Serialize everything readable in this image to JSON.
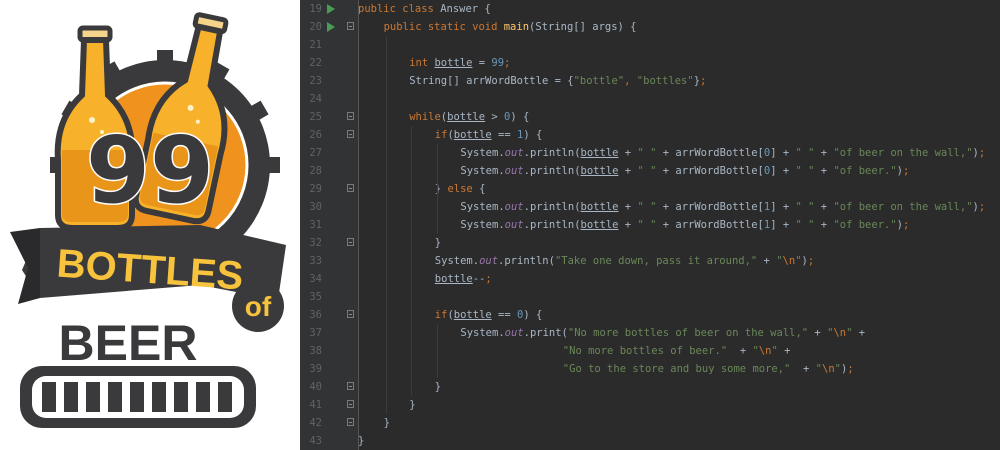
{
  "logo": {
    "number": "99",
    "word1": "BOTTLES",
    "word2": "of",
    "word3": "BEER"
  },
  "editor": {
    "lines": [
      {
        "n": "19",
        "run": true,
        "fold": false,
        "indent": 0,
        "tokens": [
          [
            "kw",
            "public "
          ],
          [
            "kw",
            "class "
          ],
          [
            "plain",
            "Answer {"
          ]
        ]
      },
      {
        "n": "20",
        "run": true,
        "fold": true,
        "indent": 4,
        "tokens": [
          [
            "kw",
            "public "
          ],
          [
            "kw",
            "static "
          ],
          [
            "kw",
            "void "
          ],
          [
            "fn",
            "main"
          ],
          [
            "plain",
            "(String[] args) {"
          ]
        ]
      },
      {
        "n": "21",
        "tokens": []
      },
      {
        "n": "22",
        "indent": 8,
        "tokens": [
          [
            "kw",
            "int "
          ],
          [
            "var",
            "bottle"
          ],
          [
            "plain",
            " = "
          ],
          [
            "num",
            "99"
          ],
          [
            "kw",
            ";"
          ]
        ]
      },
      {
        "n": "23",
        "indent": 8,
        "tokens": [
          [
            "plain",
            "String[] arrWordBottle = {"
          ],
          [
            "str",
            "\"bottle\""
          ],
          [
            "kw",
            ", "
          ],
          [
            "str",
            "\"bottles\""
          ],
          [
            "plain",
            "}"
          ],
          [
            "kw",
            ";"
          ]
        ]
      },
      {
        "n": "24",
        "tokens": []
      },
      {
        "n": "25",
        "fold": true,
        "indent": 8,
        "tokens": [
          [
            "kw",
            "while"
          ],
          [
            "plain",
            "("
          ],
          [
            "var",
            "bottle"
          ],
          [
            "plain",
            " > "
          ],
          [
            "num",
            "0"
          ],
          [
            "plain",
            ") {"
          ]
        ]
      },
      {
        "n": "26",
        "fold": true,
        "indent": 12,
        "tokens": [
          [
            "kw",
            "if"
          ],
          [
            "plain",
            "("
          ],
          [
            "var",
            "bottle"
          ],
          [
            "plain",
            " == "
          ],
          [
            "num",
            "1"
          ],
          [
            "plain",
            ") {"
          ]
        ]
      },
      {
        "n": "27",
        "indent": 16,
        "tokens": [
          [
            "plain",
            "System."
          ],
          [
            "fld",
            "out"
          ],
          [
            "plain",
            ".println("
          ],
          [
            "var",
            "bottle"
          ],
          [
            "plain",
            " + "
          ],
          [
            "str",
            "\" \""
          ],
          [
            "plain",
            " + arrWordBottle["
          ],
          [
            "num",
            "0"
          ],
          [
            "plain",
            "] + "
          ],
          [
            "str",
            "\" \""
          ],
          [
            "plain",
            " + "
          ],
          [
            "str",
            "\"of beer on the wall,\""
          ],
          [
            "plain",
            ")"
          ],
          [
            "kw",
            ";"
          ]
        ]
      },
      {
        "n": "28",
        "indent": 16,
        "tokens": [
          [
            "plain",
            "System."
          ],
          [
            "fld",
            "out"
          ],
          [
            "plain",
            ".println("
          ],
          [
            "var",
            "bottle"
          ],
          [
            "plain",
            " + "
          ],
          [
            "str",
            "\" \""
          ],
          [
            "plain",
            " + arrWordBottle["
          ],
          [
            "num",
            "0"
          ],
          [
            "plain",
            "] + "
          ],
          [
            "str",
            "\" \""
          ],
          [
            "plain",
            " + "
          ],
          [
            "str",
            "\"of beer.\""
          ],
          [
            "plain",
            ")"
          ],
          [
            "kw",
            ";"
          ]
        ]
      },
      {
        "n": "29",
        "fold": true,
        "indent": 12,
        "tokens": [
          [
            "plain",
            "} "
          ],
          [
            "kw",
            "else "
          ],
          [
            "plain",
            "{"
          ]
        ]
      },
      {
        "n": "30",
        "indent": 16,
        "tokens": [
          [
            "plain",
            "System."
          ],
          [
            "fld",
            "out"
          ],
          [
            "plain",
            ".println("
          ],
          [
            "var",
            "bottle"
          ],
          [
            "plain",
            " + "
          ],
          [
            "str",
            "\" \""
          ],
          [
            "plain",
            " + arrWordBottle["
          ],
          [
            "num",
            "1"
          ],
          [
            "plain",
            "] + "
          ],
          [
            "str",
            "\" \""
          ],
          [
            "plain",
            " + "
          ],
          [
            "str",
            "\"of beer on the wall,\""
          ],
          [
            "plain",
            ")"
          ],
          [
            "kw",
            ";"
          ]
        ]
      },
      {
        "n": "31",
        "indent": 16,
        "tokens": [
          [
            "plain",
            "System."
          ],
          [
            "fld",
            "out"
          ],
          [
            "plain",
            ".println("
          ],
          [
            "var",
            "bottle"
          ],
          [
            "plain",
            " + "
          ],
          [
            "str",
            "\" \""
          ],
          [
            "plain",
            " + arrWordBottle["
          ],
          [
            "num",
            "1"
          ],
          [
            "plain",
            "] + "
          ],
          [
            "str",
            "\" \""
          ],
          [
            "plain",
            " + "
          ],
          [
            "str",
            "\"of beer.\""
          ],
          [
            "plain",
            ")"
          ],
          [
            "kw",
            ";"
          ]
        ]
      },
      {
        "n": "32",
        "fold": true,
        "indent": 12,
        "tokens": [
          [
            "plain",
            "}"
          ]
        ]
      },
      {
        "n": "33",
        "indent": 12,
        "tokens": [
          [
            "plain",
            "System."
          ],
          [
            "fld",
            "out"
          ],
          [
            "plain",
            ".println("
          ],
          [
            "str",
            "\"Take one down, pass it around,\""
          ],
          [
            "plain",
            " + "
          ],
          [
            "str",
            "\""
          ],
          [
            "esc",
            "\\n"
          ],
          [
            "str",
            "\""
          ],
          [
            "plain",
            ")"
          ],
          [
            "kw",
            ";"
          ]
        ]
      },
      {
        "n": "34",
        "indent": 12,
        "tokens": [
          [
            "var",
            "bottle"
          ],
          [
            "plain",
            "--"
          ],
          [
            "kw",
            ";"
          ]
        ]
      },
      {
        "n": "35",
        "tokens": []
      },
      {
        "n": "36",
        "fold": true,
        "indent": 12,
        "tokens": [
          [
            "kw",
            "if"
          ],
          [
            "plain",
            "("
          ],
          [
            "var",
            "bottle"
          ],
          [
            "plain",
            " == "
          ],
          [
            "num",
            "0"
          ],
          [
            "plain",
            ") {"
          ]
        ]
      },
      {
        "n": "37",
        "indent": 16,
        "tokens": [
          [
            "plain",
            "System."
          ],
          [
            "fld",
            "out"
          ],
          [
            "plain",
            ".print("
          ],
          [
            "str",
            "\"No more bottles of beer on the wall,\""
          ],
          [
            "plain",
            " + "
          ],
          [
            "str",
            "\""
          ],
          [
            "esc",
            "\\n"
          ],
          [
            "str",
            "\""
          ],
          [
            "plain",
            " +"
          ]
        ]
      },
      {
        "n": "38",
        "indent": 32,
        "tokens": [
          [
            "str",
            "\"No more bottles of beer.\""
          ],
          [
            "plain",
            "  + "
          ],
          [
            "str",
            "\""
          ],
          [
            "esc",
            "\\n"
          ],
          [
            "str",
            "\""
          ],
          [
            "plain",
            " +"
          ]
        ]
      },
      {
        "n": "39",
        "indent": 32,
        "tokens": [
          [
            "str",
            "\"Go to the store and buy some more,\""
          ],
          [
            "plain",
            "  + "
          ],
          [
            "str",
            "\""
          ],
          [
            "esc",
            "\\n"
          ],
          [
            "str",
            "\""
          ],
          [
            "plain",
            ")"
          ],
          [
            "kw",
            ";"
          ]
        ]
      },
      {
        "n": "40",
        "fold": true,
        "indent": 12,
        "tokens": [
          [
            "plain",
            "}"
          ]
        ]
      },
      {
        "n": "41",
        "fold": true,
        "indent": 8,
        "tokens": [
          [
            "plain",
            "}"
          ]
        ]
      },
      {
        "n": "42",
        "fold": true,
        "indent": 4,
        "tokens": [
          [
            "plain",
            "}"
          ]
        ]
      },
      {
        "n": "43",
        "indent": 0,
        "tokens": [
          [
            "plain",
            "}"
          ]
        ]
      }
    ]
  },
  "colors": {
    "editor_bg": "#2b2b2b",
    "gutter_bg": "#313335",
    "keyword": "#cc7832",
    "method": "#ffc66d",
    "string": "#6a8759",
    "number": "#6897bb",
    "field": "#9876aa",
    "text": "#a9b7c6",
    "run_icon": "#499c54",
    "logo_dark": "#3a3a3c",
    "logo_orange": "#f0921e",
    "logo_gold": "#f7c23c"
  }
}
